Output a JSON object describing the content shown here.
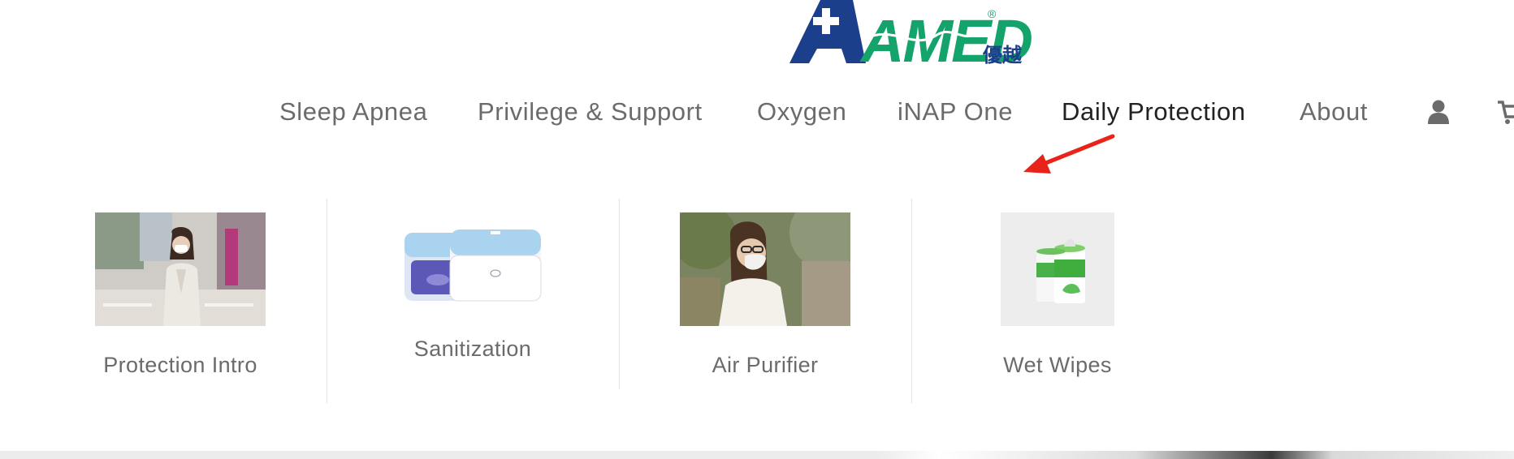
{
  "brand": {
    "logo_text": "AMED",
    "logo_registered": "®",
    "logo_chinese": "優越",
    "colors": {
      "blue": "#1c3f8c",
      "green": "#14a36b"
    }
  },
  "nav": {
    "items": [
      {
        "label": "Sleep Apnea"
      },
      {
        "label": "Privilege & Support"
      },
      {
        "label": "Oxygen"
      },
      {
        "label": "iNAP One"
      },
      {
        "label": "Daily Protection"
      },
      {
        "label": "About"
      }
    ],
    "active": "Daily Protection",
    "icons": [
      "user-icon",
      "cart-icon"
    ]
  },
  "annotation": {
    "color": "#e8231a"
  },
  "mega_menu": {
    "items": [
      {
        "label": "Protection Intro",
        "image": "woman-mask-street-photo"
      },
      {
        "label": "Sanitization",
        "image": "uv-sanitizer-box-photo"
      },
      {
        "label": "Air Purifier",
        "image": "woman-glasses-mask-photo"
      },
      {
        "label": "Wet Wipes",
        "image": "wipes-canister-photo"
      }
    ]
  }
}
